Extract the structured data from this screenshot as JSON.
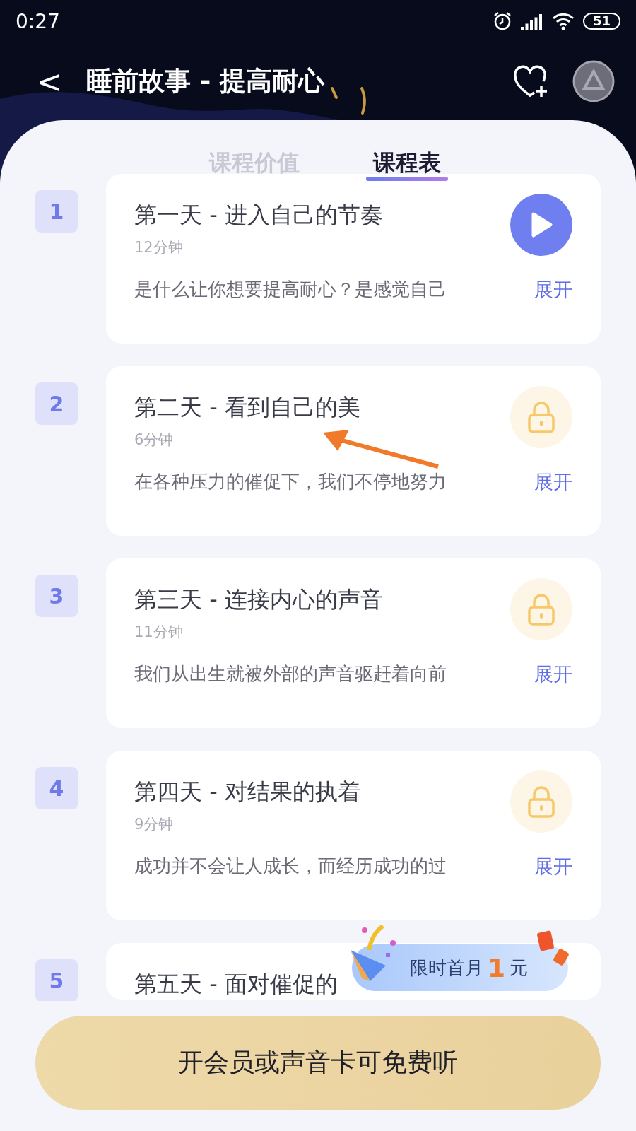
{
  "status_bar": {
    "time": "0:27",
    "battery": "51"
  },
  "header": {
    "back": "<",
    "title": "睡前故事 - 提高耐心"
  },
  "tabs": [
    {
      "label": "课程价值",
      "selected": false
    },
    {
      "label": "课程表",
      "selected": true
    }
  ],
  "lessons": [
    {
      "number": "1",
      "title": "第一天 - 进入自己的节奏",
      "duration": "12分钟",
      "summary": "是什么让你想要提高耐心？是感觉自己",
      "expand": "展开",
      "locked": false
    },
    {
      "number": "2",
      "title": "第二天 - 看到自己的美",
      "duration": "6分钟",
      "summary": "在各种压力的催促下，我们不停地努力",
      "expand": "展开",
      "locked": true
    },
    {
      "number": "3",
      "title": "第三天 - 连接内心的声音",
      "duration": "11分钟",
      "summary": "我们从出生就被外部的声音驱赶着向前",
      "expand": "展开",
      "locked": true
    },
    {
      "number": "4",
      "title": "第四天 - 对结果的执着",
      "duration": "9分钟",
      "summary": "成功并不会让人成长，而经历成功的过",
      "expand": "展开",
      "locked": true
    },
    {
      "number": "5",
      "title": "第五天 - 面对催促的"
    }
  ],
  "promo": {
    "text": "限时首月",
    "price": "1",
    "unit": "元"
  },
  "cta": "开会员或声音卡可免费听"
}
